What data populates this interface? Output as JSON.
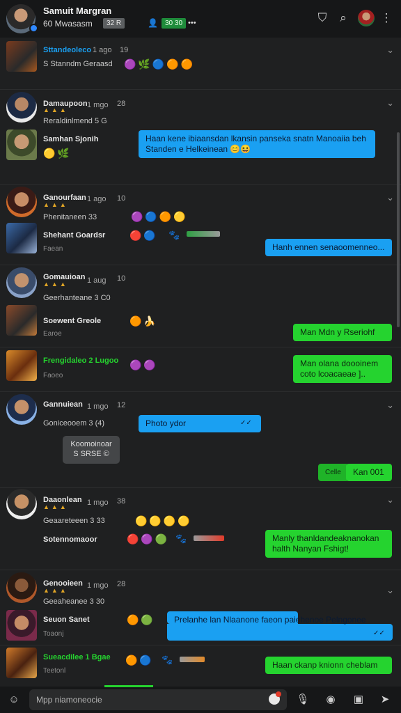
{
  "header": {
    "title": "Samuit Margran",
    "subtitle": "60   Mwasasm",
    "chip_gray": "32 R",
    "chip_green": "30 30",
    "more": "•••"
  },
  "messages": [
    {
      "name": "Sttandeoleco",
      "time": "1 ago",
      "count": "19",
      "line": "S Stanndm Geraasd",
      "emojis": "🟣🌿🔵🟠🟠"
    },
    {
      "name": "Damaupoon",
      "time": "1 mgo",
      "count": "28",
      "line": "Reraldinlmend   5 G"
    },
    {
      "name": "Samhan Sjonih",
      "emojis": "🟡🌿",
      "bubble": "Haan kene ibiaansdan lkansin panseka snatn Manoaiia beh Standen e Helkeinean 😊😆"
    },
    {
      "name": "Ganourfaan",
      "time": "1 ago",
      "count": "10",
      "line": "Phenitaneen   33",
      "emojis": "🟣🔵🟠🟡"
    },
    {
      "name": "Shehant Goardsr",
      "sub": "Faean",
      "emojis": "🔴🔵",
      "bubble": "Hanh ennen senaoomenneo..."
    },
    {
      "name": "Gomauioan",
      "time": "1 aug",
      "count": "10",
      "line": "Geerhanteane   3 C0"
    },
    {
      "name": "Soewent Greole",
      "sub": "Earoe",
      "emojis": "🟠🍌",
      "bubble": "Man Mdn y Rseriohf"
    },
    {
      "name": "Frengidaleo 2 Lugoo",
      "sub": "Faoeo",
      "emojis": "🟣🟣",
      "bubble": "Man olana doooinem coto lcoacaeae ].."
    },
    {
      "name": "Gannuiean",
      "time": "1 mgo",
      "count": "12",
      "line": "Goniceooem   3 (4)",
      "bubble": "Photo ydor"
    },
    {
      "toast_line1": "Koomoinoar",
      "toast_line2": "S SRSE ©"
    },
    {
      "bubble_small": "Celle",
      "bubble_green": "Kan 001"
    },
    {
      "name": "Daaonlean",
      "time": "1 mgo",
      "count": "38",
      "line": "Geaareteeen   3 33",
      "emojis": "🟡🟡🟡🟡"
    },
    {
      "name": "Sotennomaoor",
      "emojis": "🔴🟣🟢",
      "bubble": "Manly thanldandeaknanokan halth Nanyan Fshigt!"
    },
    {
      "name": "Genooieen",
      "time": "1 mgo",
      "count": "28",
      "line": "Geeaheanee   3 30"
    },
    {
      "name": "Seuon Sanet",
      "sub": "Toaonj",
      "emojis": "🟠🟢",
      "bubble": "Prelanhe lan Nlaanone faeon paiehenoe Pelngonee"
    },
    {
      "name": "Sueacdilee 1 Bgae",
      "sub": "Teetonl",
      "emojis": "🟠🔵",
      "bubble": "Haan ckanp knionn cheblam"
    }
  ],
  "footer": {
    "placeholder": "Mpp niamoneocie"
  }
}
